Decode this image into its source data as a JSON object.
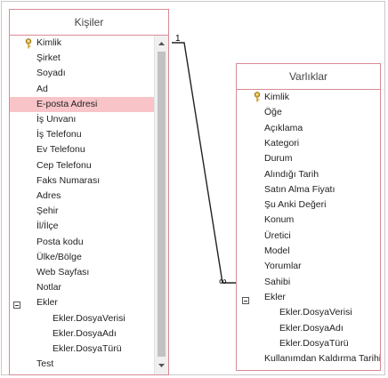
{
  "tables": {
    "kisiler": {
      "title": "Kişiler",
      "fields": [
        "Kimlik",
        "Şirket",
        "Soyadı",
        "Ad",
        "E-posta Adresi",
        "İş Unvanı",
        "İş Telefonu",
        "Ev Telefonu",
        "Cep Telefonu",
        "Faks Numarası",
        "Adres",
        "Şehir",
        "İl/İlçe",
        "Posta kodu",
        "Ülke/Bölge",
        "Web Sayfası",
        "Notlar",
        "Ekler",
        "Ekler.DosyaVerisi",
        "Ekler.DosyaAdı",
        "Ekler.DosyaTürü",
        "Test"
      ],
      "selected_field": "E-posta Adresi"
    },
    "varliklar": {
      "title": "Varlıklar",
      "fields": [
        "Kimlik",
        "Öğe",
        "Açıklama",
        "Kategori",
        "Durum",
        "Alındığı Tarih",
        "Satın Alma Fiyatı",
        "Şu Anki Değeri",
        "Konum",
        "Üretici",
        "Model",
        "Yorumlar",
        "Sahibi",
        "Ekler",
        "Ekler.DosyaVerisi",
        "Ekler.DosyaAdı",
        "Ekler.DosyaTürü",
        "Kullanımdan Kaldırma Tarihi"
      ]
    }
  },
  "relationship": {
    "one_side": "1",
    "many_side": "∞"
  },
  "icons": {
    "primary_key": "key-icon",
    "expand": "collapse-minus-icon",
    "scroll_up": "scroll-up-arrow-icon",
    "scroll_down": "scroll-down-arrow-icon"
  }
}
